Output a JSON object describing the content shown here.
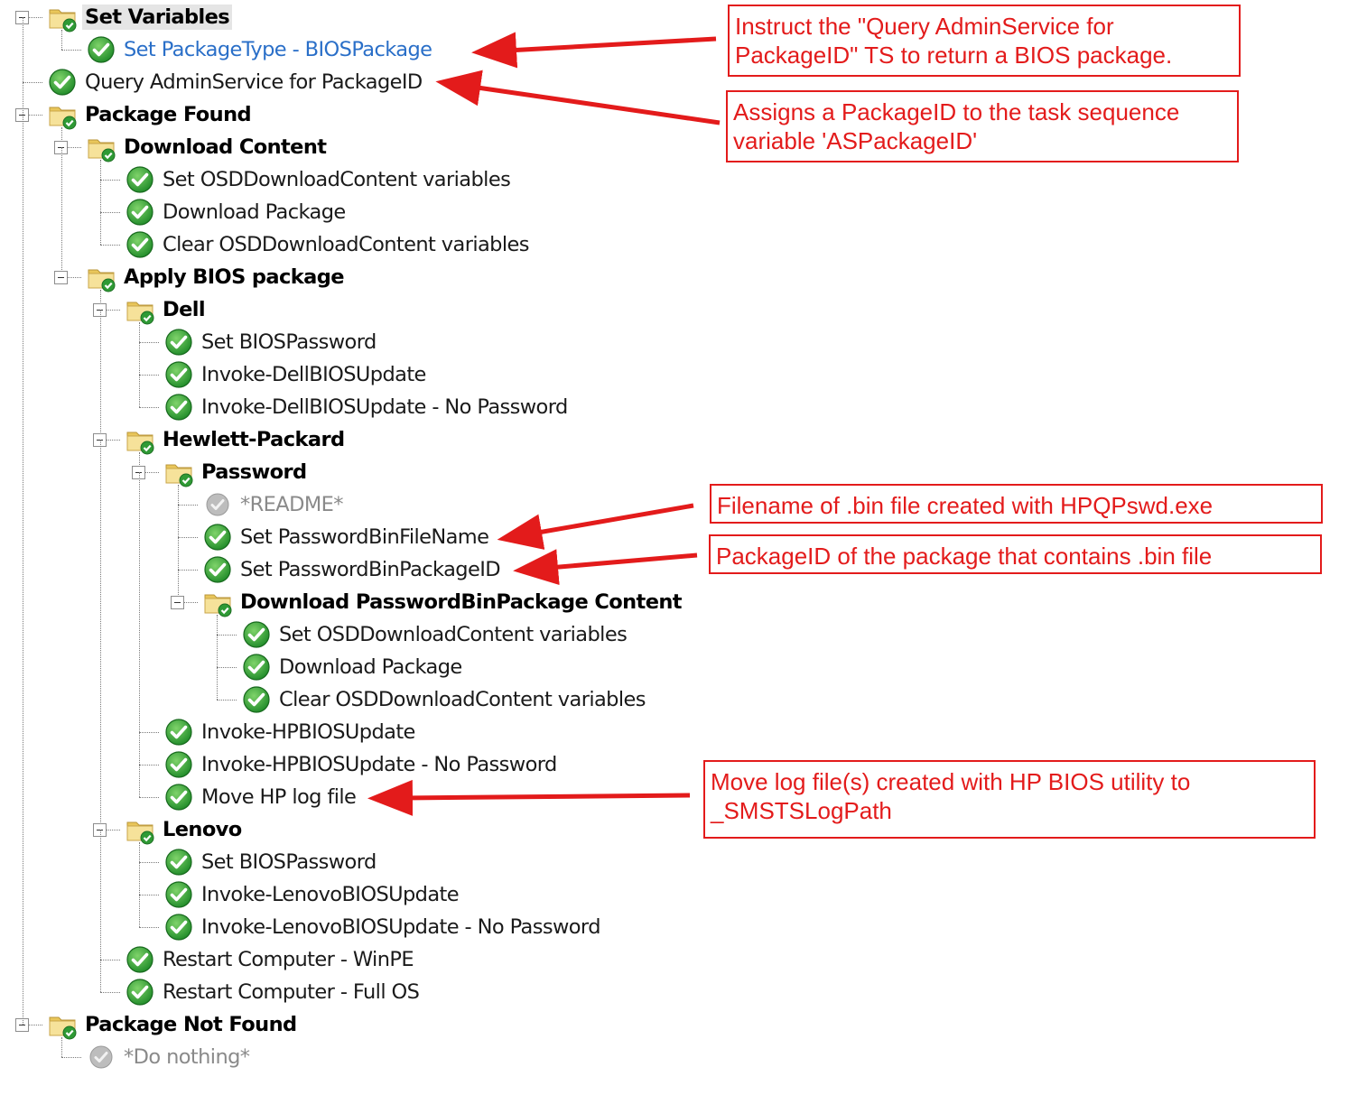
{
  "tree": [
    {
      "label": "Set Variables",
      "kind": "group",
      "expanded": true,
      "selected": true,
      "icon": "folder-check-icon"
    },
    {
      "label": "Set PackageType - BIOSPackage",
      "kind": "step",
      "highlight": true,
      "icon": "check-circle-icon"
    },
    {
      "label": "Query AdminService for PackageID",
      "kind": "step",
      "icon": "check-circle-icon"
    },
    {
      "label": "Package Found",
      "kind": "group",
      "expanded": true,
      "icon": "folder-check-icon"
    },
    {
      "label": "Download Content",
      "kind": "group",
      "expanded": true,
      "icon": "folder-check-icon"
    },
    {
      "label": "Set OSDDownloadContent variables",
      "kind": "step",
      "icon": "check-circle-icon"
    },
    {
      "label": "Download Package",
      "kind": "step",
      "icon": "check-circle-icon"
    },
    {
      "label": "Clear OSDDownloadContent variables",
      "kind": "step",
      "icon": "check-circle-icon"
    },
    {
      "label": "Apply BIOS package",
      "kind": "group",
      "expanded": true,
      "icon": "folder-check-icon"
    },
    {
      "label": "Dell",
      "kind": "group",
      "expanded": true,
      "icon": "folder-check-icon"
    },
    {
      "label": "Set BIOSPassword",
      "kind": "step",
      "icon": "check-circle-icon"
    },
    {
      "label": "Invoke-DellBIOSUpdate",
      "kind": "step",
      "icon": "check-circle-icon"
    },
    {
      "label": "Invoke-DellBIOSUpdate - No Password",
      "kind": "step",
      "icon": "check-circle-icon"
    },
    {
      "label": "Hewlett-Packard",
      "kind": "group",
      "expanded": true,
      "icon": "folder-check-icon"
    },
    {
      "label": "Password",
      "kind": "group",
      "expanded": true,
      "icon": "folder-check-icon"
    },
    {
      "label": "*README*",
      "kind": "step",
      "disabled": true,
      "icon": "check-circle-disabled-icon"
    },
    {
      "label": "Set PasswordBinFileName",
      "kind": "step",
      "icon": "check-circle-icon"
    },
    {
      "label": "Set PasswordBinPackageID",
      "kind": "step",
      "icon": "check-circle-icon"
    },
    {
      "label": "Download PasswordBinPackage Content",
      "kind": "group",
      "expanded": true,
      "icon": "folder-check-icon"
    },
    {
      "label": "Set OSDDownloadContent variables",
      "kind": "step",
      "icon": "check-circle-icon"
    },
    {
      "label": "Download Package",
      "kind": "step",
      "icon": "check-circle-icon"
    },
    {
      "label": "Clear OSDDownloadContent variables",
      "kind": "step",
      "icon": "check-circle-icon"
    },
    {
      "label": "Invoke-HPBIOSUpdate",
      "kind": "step",
      "icon": "check-circle-icon"
    },
    {
      "label": "Invoke-HPBIOSUpdate - No Password",
      "kind": "step",
      "icon": "check-circle-icon"
    },
    {
      "label": "Move HP log file",
      "kind": "step",
      "icon": "check-circle-icon"
    },
    {
      "label": "Lenovo",
      "kind": "group",
      "expanded": true,
      "icon": "folder-check-icon"
    },
    {
      "label": "Set BIOSPassword",
      "kind": "step",
      "icon": "check-circle-icon"
    },
    {
      "label": "Invoke-LenovoBIOSUpdate",
      "kind": "step",
      "icon": "check-circle-icon"
    },
    {
      "label": "Invoke-LenovoBIOSUpdate - No Password",
      "kind": "step",
      "icon": "check-circle-icon"
    },
    {
      "label": "Restart Computer - WinPE",
      "kind": "step",
      "icon": "check-circle-icon"
    },
    {
      "label": "Restart Computer - Full OS",
      "kind": "step",
      "icon": "check-circle-icon"
    },
    {
      "label": "Package Not Found",
      "kind": "group",
      "expanded": true,
      "icon": "folder-check-icon"
    },
    {
      "label": "*Do nothing*",
      "kind": "step",
      "disabled": true,
      "icon": "check-circle-disabled-icon"
    }
  ],
  "callouts": [
    {
      "text": "Instruct the \"Query AdminService for PackageID\" TS to return a BIOS package."
    },
    {
      "text": "Assigns a PackageID to the task sequence variable 'ASPackageID'"
    },
    {
      "text": "Filename of .bin file created with HPQPswd.exe"
    },
    {
      "text": "PackageID of the package that contains .bin file"
    },
    {
      "text": "Move log file(s) created with HP BIOS utility to _SMSTSLogPath"
    }
  ],
  "colors": {
    "annotation": "#e31b1b",
    "selected_row": "#e5e5e5",
    "highlight_text": "#2a6fc8",
    "check_green": "#1f9a2a",
    "folder_yellow": "#f3d97a"
  }
}
